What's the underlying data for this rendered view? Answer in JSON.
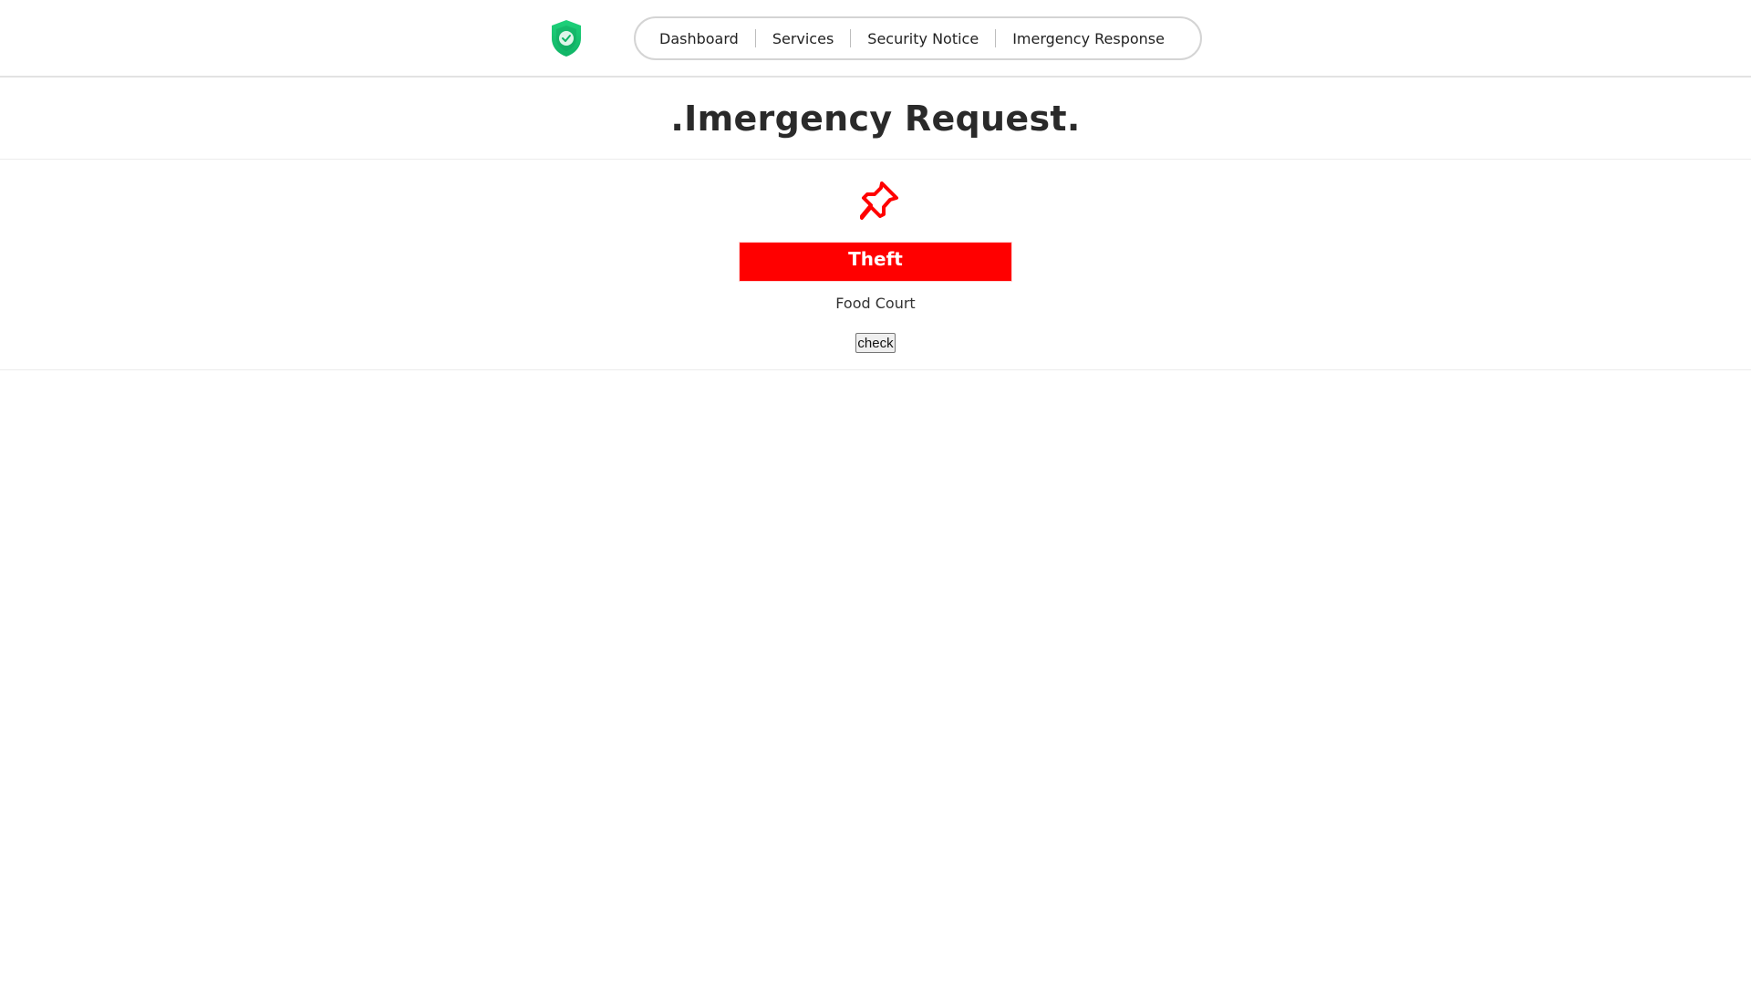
{
  "nav": {
    "items": [
      {
        "label": "Dashboard"
      },
      {
        "label": "Services"
      },
      {
        "label": "Security Notice"
      },
      {
        "label": "Imergency Response"
      }
    ]
  },
  "page": {
    "title": ".Imergency Request."
  },
  "request": {
    "icon": "pushpin-icon",
    "type": "Theft",
    "location": "Food Court",
    "check_label": "check"
  },
  "colors": {
    "logo_green": "#22c55e",
    "alert_red": "#ff0000"
  }
}
